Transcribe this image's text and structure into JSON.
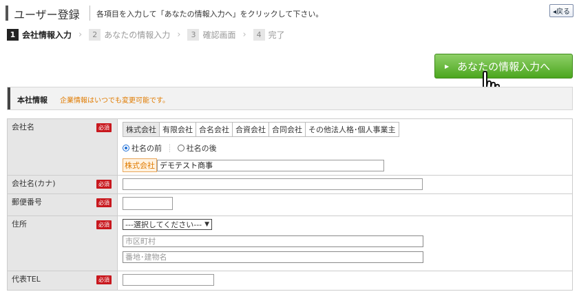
{
  "header": {
    "title": "ユーザー登録",
    "instruction": "各項目を入力して「あなたの情報入力へ」をクリックして下さい。",
    "back_label": "戻る"
  },
  "steps": [
    {
      "num": "1",
      "label": "会社情報入力",
      "active": true
    },
    {
      "num": "2",
      "label": "あなたの情報入力",
      "active": false
    },
    {
      "num": "3",
      "label": "確認画面",
      "active": false
    },
    {
      "num": "4",
      "label": "完了",
      "active": false
    }
  ],
  "proceed_button": {
    "label": "あなたの情報入力へ"
  },
  "section": {
    "title": "本社情報",
    "note": "企業情報はいつでも変更可能です。"
  },
  "required_badge": "必須",
  "fields": {
    "company_name": {
      "label": "会社名",
      "tabs": [
        "株式会社",
        "有限会社",
        "合名会社",
        "合資会社",
        "合同会社",
        "その他法人格･個人事業主"
      ],
      "position_options": [
        "社名の前",
        "社名の後"
      ],
      "selected_prefix": "株式会社",
      "value": "デモテスト商事"
    },
    "company_kana": {
      "label": "会社名(カナ)",
      "value": ""
    },
    "postal_code": {
      "label": "郵便番号",
      "value": ""
    },
    "address": {
      "label": "住所",
      "prefecture_select": "---選択してください---",
      "city_placeholder": "市区町村",
      "street_placeholder": "番地･建物名"
    },
    "phone": {
      "label": "代表TEL",
      "value": ""
    }
  },
  "colors": {
    "accent_green": "#4ba61e",
    "required_red": "#c8181e",
    "note_orange": "#e07b00"
  }
}
